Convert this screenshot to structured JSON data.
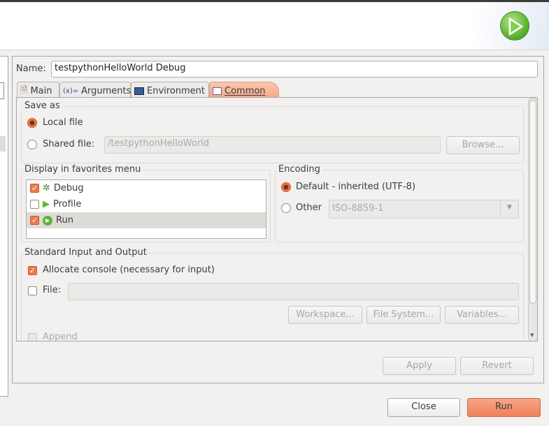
{
  "name": {
    "label": "Name:",
    "value": "testpythonHelloWorld Debug"
  },
  "tabs": [
    {
      "label": "Main",
      "icon": "document-icon"
    },
    {
      "label": "Arguments",
      "icon": "variables-icon"
    },
    {
      "label": "Environment",
      "icon": "environment-icon"
    },
    {
      "label": "Common",
      "icon": "table-icon",
      "active": true
    }
  ],
  "save_as": {
    "title": "Save as",
    "local_file": "Local file",
    "shared_file": "Shared file:",
    "shared_path": "/testpythonHelloWorld",
    "browse": "Browse...",
    "selected": "Local file"
  },
  "favorites": {
    "title": "Display in favorites menu",
    "items": [
      {
        "label": "Debug",
        "checked": true,
        "icon": "bug-icon"
      },
      {
        "label": "Profile",
        "checked": false,
        "icon": "profile-icon"
      },
      {
        "label": "Run",
        "checked": true,
        "icon": "run-icon",
        "selected": true
      }
    ]
  },
  "encoding": {
    "title": "Encoding",
    "default": "Default - inherited (UTF-8)",
    "other": "Other",
    "other_value": "ISO-8859-1",
    "selected": "default"
  },
  "std_io": {
    "title": "Standard Input and Output",
    "allocate_console": "Allocate console (necessary for input)",
    "allocate_checked": true,
    "file": "File:",
    "file_checked": false,
    "workspace": "Workspace...",
    "file_system": "File System...",
    "variables": "Variables...",
    "append": "Append"
  },
  "buttons": {
    "apply": "Apply",
    "revert": "Revert",
    "close": "Close",
    "run": "Run"
  },
  "colors": {
    "accent": "#ef7a4e",
    "run_icon": "#5cb531"
  }
}
